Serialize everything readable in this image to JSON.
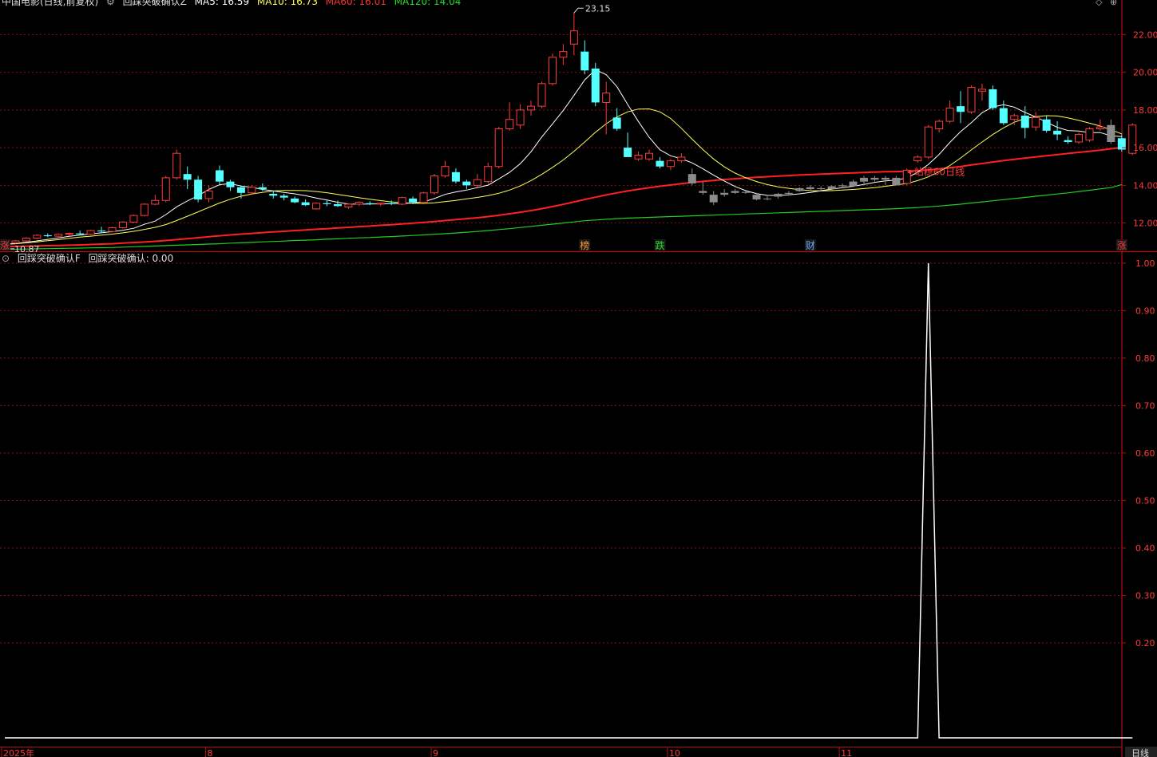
{
  "colors": {
    "up": "#ff3b3b",
    "down": "#54ffff",
    "gray": "#8c8c8c",
    "ma5": "#ffffff",
    "ma10": "#ffff55",
    "ma60": "#ff2020",
    "ma120": "#22cc22",
    "grid": "#8a1010",
    "axis": "#b01010",
    "signal": "#ffffff"
  },
  "top_header": {
    "title": "中国电影(日线,前复权)",
    "indicator": "回踩突破确认Z",
    "ma5": "MA5: 16.59",
    "ma10": "MA10: 16.73",
    "ma60": "MA60: 16.01",
    "ma120": "MA120: 14.04"
  },
  "bottom_header": {
    "indicator": "回踩突破确认F",
    "value_text": "回踩突破确认: 0.00"
  },
  "icons": {
    "gear": "gear-icon",
    "dropdown": "chevron-down-icon",
    "settings": "settings-icon",
    "close": "close-icon"
  },
  "chart_data": [
    {
      "type": "candlestick",
      "y_axis": {
        "range": [
          10.5,
          23.5
        ],
        "ticks": [
          "12.00",
          "14.00",
          "16.00",
          "18.00",
          "20.00",
          "22.00"
        ]
      },
      "ohlc": [
        [
          10.87,
          10.95,
          10.8,
          10.9
        ],
        [
          10.95,
          11.1,
          10.9,
          11.05
        ],
        [
          11.05,
          11.25,
          11.0,
          11.2
        ],
        [
          11.2,
          11.4,
          11.15,
          11.35
        ],
        [
          11.35,
          11.45,
          11.25,
          11.3
        ],
        [
          11.3,
          11.45,
          11.2,
          11.4
        ],
        [
          11.4,
          11.5,
          11.3,
          11.45
        ],
        [
          11.45,
          11.6,
          11.35,
          11.4
        ],
        [
          11.4,
          11.65,
          11.35,
          11.6
        ],
        [
          11.6,
          11.8,
          11.5,
          11.55
        ],
        [
          11.55,
          11.8,
          11.5,
          11.75
        ],
        [
          11.75,
          12.1,
          11.7,
          12.05
        ],
        [
          12.05,
          12.45,
          12.0,
          12.4
        ],
        [
          12.4,
          13.05,
          12.35,
          13.0
        ],
        [
          13.0,
          13.5,
          12.95,
          13.2
        ],
        [
          13.2,
          14.5,
          13.1,
          14.4
        ],
        [
          14.4,
          15.9,
          14.3,
          15.7
        ],
        [
          14.6,
          15.0,
          13.8,
          14.3
        ],
        [
          14.3,
          14.5,
          13.1,
          13.25
        ],
        [
          13.3,
          14.0,
          13.1,
          13.7
        ],
        [
          14.8,
          15.05,
          14.0,
          14.2
        ],
        [
          14.2,
          14.3,
          13.7,
          13.9
        ],
        [
          13.9,
          14.0,
          13.3,
          13.6
        ],
        [
          13.6,
          14.0,
          13.5,
          13.9
        ],
        [
          13.9,
          14.1,
          13.7,
          13.8
        ],
        [
          13.55,
          13.7,
          13.3,
          13.45
        ],
        [
          13.45,
          13.55,
          13.2,
          13.35
        ],
        [
          13.3,
          13.4,
          13.05,
          13.1
        ],
        [
          13.1,
          13.25,
          12.9,
          12.95
        ],
        [
          12.75,
          13.1,
          12.7,
          13.05
        ],
        [
          13.05,
          13.2,
          12.9,
          13.0
        ],
        [
          13.0,
          13.2,
          12.85,
          12.9
        ],
        [
          12.85,
          13.05,
          12.75,
          13.0
        ],
        [
          13.0,
          13.15,
          12.9,
          13.1
        ],
        [
          13.05,
          13.15,
          12.95,
          13.0
        ],
        [
          13.0,
          13.1,
          12.9,
          13.05
        ],
        [
          13.05,
          13.2,
          12.95,
          13.0
        ],
        [
          13.0,
          13.4,
          12.95,
          13.35
        ],
        [
          13.3,
          13.4,
          13.0,
          13.1
        ],
        [
          13.1,
          13.65,
          13.05,
          13.6
        ],
        [
          13.6,
          14.6,
          13.5,
          14.5
        ],
        [
          14.5,
          15.3,
          14.4,
          15.0
        ],
        [
          14.7,
          14.9,
          14.1,
          14.2
        ],
        [
          14.2,
          14.3,
          13.8,
          14.0
        ],
        [
          14.0,
          14.6,
          13.9,
          14.3
        ],
        [
          14.2,
          15.2,
          14.1,
          15.0
        ],
        [
          15.0,
          17.1,
          14.9,
          17.0
        ],
        [
          17.0,
          18.4,
          16.9,
          17.5
        ],
        [
          17.2,
          18.3,
          17.0,
          18.0
        ],
        [
          18.0,
          18.5,
          17.7,
          18.2
        ],
        [
          18.2,
          19.5,
          18.1,
          19.4
        ],
        [
          19.4,
          21.0,
          19.3,
          20.8
        ],
        [
          20.8,
          21.5,
          20.4,
          21.1
        ],
        [
          21.5,
          23.15,
          20.9,
          22.2
        ],
        [
          21.1,
          21.7,
          19.9,
          20.1
        ],
        [
          20.2,
          20.5,
          18.2,
          18.4
        ],
        [
          18.4,
          19.5,
          16.7,
          18.9
        ],
        [
          17.6,
          18.1,
          16.9,
          17.0
        ],
        [
          16.0,
          16.8,
          15.5,
          15.5
        ],
        [
          15.4,
          15.8,
          15.3,
          15.6
        ],
        [
          15.4,
          15.9,
          15.3,
          15.7
        ],
        [
          15.3,
          15.5,
          14.9,
          15.0
        ],
        [
          15.0,
          15.4,
          14.8,
          15.3
        ],
        [
          15.3,
          15.7,
          15.2,
          15.5
        ],
        [
          14.6,
          14.9,
          14.0,
          14.1
        ],
        [
          13.7,
          14.2,
          13.5,
          13.6
        ],
        [
          13.5,
          13.7,
          12.95,
          13.1
        ],
        [
          13.5,
          13.8,
          13.4,
          13.6
        ],
        [
          13.7,
          13.8,
          13.55,
          13.6
        ],
        [
          13.65,
          13.7,
          13.55,
          13.6
        ],
        [
          13.5,
          13.6,
          13.2,
          13.25
        ],
        [
          13.3,
          13.5,
          13.2,
          13.3
        ],
        [
          13.4,
          13.6,
          13.3,
          13.55
        ],
        [
          13.55,
          13.7,
          13.45,
          13.6
        ],
        [
          13.7,
          13.9,
          13.65,
          13.85
        ],
        [
          13.8,
          14.0,
          13.7,
          13.9
        ],
        [
          13.85,
          13.95,
          13.7,
          13.8
        ],
        [
          13.8,
          14.0,
          13.75,
          13.95
        ],
        [
          13.95,
          14.1,
          13.85,
          14.0
        ],
        [
          13.95,
          14.3,
          13.9,
          14.2
        ],
        [
          14.2,
          14.5,
          14.0,
          14.4
        ],
        [
          14.4,
          14.5,
          14.2,
          14.3
        ],
        [
          14.3,
          14.5,
          14.0,
          14.4
        ],
        [
          14.4,
          14.5,
          14.1,
          14.0
        ],
        [
          14.1,
          14.9,
          14.0,
          14.8
        ],
        [
          15.3,
          15.6,
          15.2,
          15.5
        ],
        [
          15.5,
          17.2,
          15.4,
          17.1
        ],
        [
          17.0,
          17.5,
          16.8,
          17.4
        ],
        [
          17.4,
          18.5,
          17.3,
          18.1
        ],
        [
          18.2,
          19.0,
          17.3,
          17.9
        ],
        [
          17.9,
          19.3,
          17.8,
          19.2
        ],
        [
          19.0,
          19.4,
          18.5,
          19.1
        ],
        [
          19.1,
          19.3,
          18.0,
          18.1
        ],
        [
          18.1,
          18.5,
          17.2,
          17.3
        ],
        [
          17.5,
          17.8,
          17.2,
          17.7
        ],
        [
          17.7,
          18.2,
          16.5,
          17.05
        ],
        [
          17.1,
          17.9,
          16.9,
          17.6
        ],
        [
          17.5,
          17.7,
          16.8,
          16.9
        ],
        [
          16.9,
          17.4,
          16.4,
          16.7
        ],
        [
          16.4,
          16.6,
          16.2,
          16.3
        ],
        [
          16.3,
          16.8,
          16.2,
          16.7
        ],
        [
          16.4,
          17.1,
          16.3,
          17.0
        ],
        [
          17.0,
          17.5,
          16.9,
          17.1
        ],
        [
          17.2,
          17.5,
          16.2,
          16.3
        ],
        [
          16.5,
          16.7,
          15.8,
          15.9
        ],
        [
          15.7,
          17.3,
          15.6,
          17.2
        ]
      ],
      "ma5": [
        10.87,
        10.92,
        10.98,
        11.05,
        11.13,
        11.21,
        11.29,
        11.36,
        11.42,
        11.48,
        11.54,
        11.62,
        11.72,
        11.93,
        12.1,
        12.45,
        12.86,
        13.17,
        13.45,
        13.78,
        14.03,
        14.1,
        13.96,
        13.9,
        13.78,
        13.7,
        13.62,
        13.55,
        13.45,
        13.33,
        13.22,
        13.1,
        13.01,
        13.0,
        13.01,
        13.02,
        13.02,
        13.04,
        13.06,
        13.12,
        13.3,
        13.52,
        13.65,
        13.75,
        13.88,
        14.01,
        14.34,
        14.69,
        15.15,
        15.78,
        16.57,
        17.26,
        17.98,
        18.77,
        19.6,
        20.14,
        19.87,
        19.24,
        18.29,
        17.39,
        16.55,
        15.89,
        15.57,
        15.41,
        15.19,
        14.88,
        14.54,
        14.23,
        13.94,
        13.72,
        13.56,
        13.47,
        13.46,
        13.5,
        13.55,
        13.62,
        13.72,
        13.8,
        13.88,
        13.95,
        14.05,
        14.16,
        14.24,
        14.28,
        14.39,
        14.7,
        15.11,
        15.64,
        16.28,
        16.85,
        17.33,
        17.86,
        18.16,
        18.28,
        18.15,
        17.87,
        17.63,
        17.35,
        17.08,
        16.91,
        16.88,
        16.8,
        16.8,
        16.63,
        16.59
      ],
      "ma10": [
        10.87,
        10.9,
        10.95,
        11.0,
        11.06,
        11.12,
        11.19,
        11.25,
        11.3,
        11.36,
        11.41,
        11.48,
        11.56,
        11.66,
        11.77,
        11.92,
        12.13,
        12.36,
        12.59,
        12.83,
        13.06,
        13.26,
        13.42,
        13.54,
        13.63,
        13.7,
        13.73,
        13.73,
        13.72,
        13.67,
        13.61,
        13.52,
        13.43,
        13.34,
        13.26,
        13.19,
        13.12,
        13.08,
        13.05,
        13.04,
        13.07,
        13.14,
        13.2,
        13.28,
        13.36,
        13.45,
        13.58,
        13.75,
        13.97,
        14.25,
        14.58,
        14.95,
        15.35,
        15.8,
        16.3,
        16.82,
        17.27,
        17.63,
        17.9,
        18.05,
        18.06,
        17.9,
        17.55,
        17.03,
        16.45,
        15.9,
        15.4,
        14.98,
        14.65,
        14.4,
        14.2,
        14.04,
        13.92,
        13.84,
        13.77,
        13.72,
        13.7,
        13.72,
        13.75,
        13.78,
        13.83,
        13.88,
        13.95,
        14.02,
        14.1,
        14.25,
        14.45,
        14.72,
        15.05,
        15.45,
        15.88,
        16.3,
        16.7,
        17.05,
        17.35,
        17.55,
        17.65,
        17.7,
        17.68,
        17.58,
        17.45,
        17.3,
        17.15,
        16.95,
        16.73
      ],
      "ma60": [
        10.75,
        10.76,
        10.77,
        10.78,
        10.8,
        10.81,
        10.82,
        10.84,
        10.86,
        10.88,
        10.9,
        10.93,
        10.96,
        10.99,
        11.03,
        11.07,
        11.12,
        11.17,
        11.22,
        11.27,
        11.32,
        11.37,
        11.41,
        11.45,
        11.49,
        11.53,
        11.56,
        11.6,
        11.63,
        11.67,
        11.7,
        11.74,
        11.77,
        11.81,
        11.84,
        11.88,
        11.91,
        11.95,
        11.99,
        12.03,
        12.08,
        12.13,
        12.18,
        12.23,
        12.28,
        12.34,
        12.41,
        12.49,
        12.57,
        12.66,
        12.76,
        12.87,
        12.99,
        13.12,
        13.25,
        13.37,
        13.49,
        13.6,
        13.7,
        13.79,
        13.87,
        13.95,
        14.02,
        14.09,
        14.15,
        14.21,
        14.26,
        14.31,
        14.35,
        14.39,
        14.43,
        14.46,
        14.49,
        14.52,
        14.55,
        14.57,
        14.6,
        14.62,
        14.64,
        14.66,
        14.68,
        14.7,
        14.72,
        14.73,
        14.75,
        14.78,
        14.82,
        14.87,
        14.93,
        15.0,
        15.08,
        15.16,
        15.24,
        15.31,
        15.38,
        15.45,
        15.51,
        15.57,
        15.63,
        15.69,
        15.75,
        15.81,
        15.87,
        15.94,
        16.01
      ],
      "ma120": [
        10.6,
        10.61,
        10.62,
        10.63,
        10.64,
        10.65,
        10.66,
        10.67,
        10.68,
        10.69,
        10.7,
        10.72,
        10.74,
        10.76,
        10.78,
        10.8,
        10.82,
        10.84,
        10.86,
        10.88,
        10.9,
        10.93,
        10.95,
        10.97,
        11.0,
        11.02,
        11.04,
        11.07,
        11.09,
        11.11,
        11.14,
        11.16,
        11.19,
        11.21,
        11.23,
        11.26,
        11.28,
        11.31,
        11.34,
        11.37,
        11.4,
        11.43,
        11.47,
        11.51,
        11.55,
        11.6,
        11.65,
        11.7,
        11.76,
        11.82,
        11.88,
        11.94,
        12.0,
        12.06,
        12.12,
        12.16,
        12.2,
        12.23,
        12.26,
        12.28,
        12.3,
        12.32,
        12.34,
        12.36,
        12.38,
        12.4,
        12.42,
        12.44,
        12.46,
        12.48,
        12.5,
        12.52,
        12.54,
        12.56,
        12.58,
        12.6,
        12.62,
        12.64,
        12.66,
        12.68,
        12.7,
        12.72,
        12.74,
        12.76,
        12.79,
        12.82,
        12.86,
        12.9,
        12.95,
        13.0,
        13.06,
        13.12,
        13.18,
        13.24,
        13.3,
        13.36,
        13.42,
        13.48,
        13.54,
        13.6,
        13.67,
        13.74,
        13.81,
        13.88,
        14.04
      ],
      "gray_bars": [
        64,
        65,
        66,
        67,
        68,
        69,
        70,
        71,
        72,
        73,
        74,
        75,
        76,
        77,
        78,
        79,
        80,
        81,
        82,
        83,
        103
      ],
      "annotations": {
        "high": "23.15",
        "low": "10.87",
        "ma60_label": "站稳60日线",
        "markers": [
          {
            "index": 0,
            "text": "涨",
            "color": "#ff3b3b"
          },
          {
            "index": 54,
            "text": "榜",
            "color": "#ff9933"
          },
          {
            "index": 61,
            "text": "跌",
            "color": "#22dd22"
          },
          {
            "index": 75,
            "text": "财",
            "color": "#66aaff"
          },
          {
            "index": 104,
            "text": "涨",
            "color": "#ff3b3b"
          }
        ]
      }
    },
    {
      "type": "line",
      "series_value_at_index": {
        "86": 1
      },
      "y_axis": {
        "range": [
          0,
          1.02
        ],
        "ticks": [
          "0.20",
          "0.30",
          "0.40",
          "0.50",
          "0.60",
          "0.70",
          "0.80",
          "0.90",
          "1.00"
        ]
      },
      "x_axis": {
        "labels": [
          "2025年",
          "8",
          "9",
          "10",
          "11"
        ],
        "label_indices": [
          0,
          19,
          40,
          62,
          78
        ]
      },
      "period_label": "日线"
    }
  ]
}
